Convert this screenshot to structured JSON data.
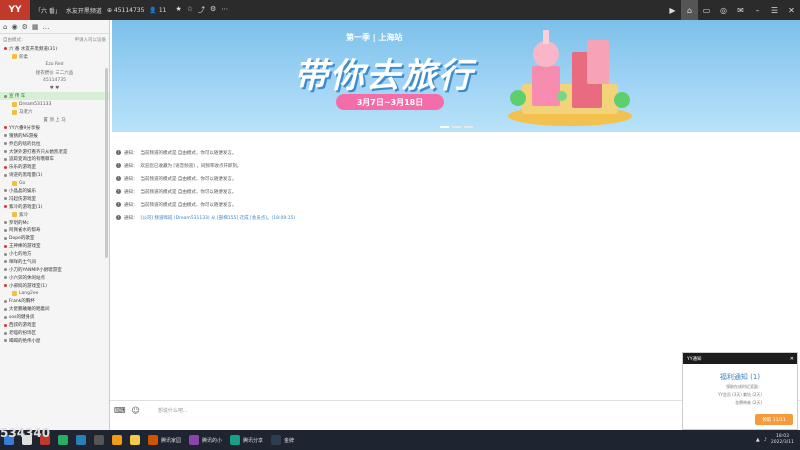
{
  "titlebar": {
    "channel_name": "「六 番」",
    "channel_desc": "水友开黑频道",
    "channel_id": "45114735",
    "online_count": "11",
    "buttons": [
      "video",
      "home",
      "screen",
      "game",
      "mail",
      "mini",
      "menu",
      "close"
    ]
  },
  "sidebar": {
    "mode_label": "自由模式：",
    "entry_hint": "申请入司以设备",
    "items": [
      {
        "text": "六 番   水友开黑频道(31)",
        "kind": "main"
      },
      {
        "text": "卯柔",
        "kind": "sub"
      },
      {
        "text": "Ezo Red",
        "kind": "center"
      },
      {
        "text": "接衣攒价 三二六品",
        "kind": "center"
      },
      {
        "text": "45114735",
        "kind": "center"
      },
      {
        "text": "♥  ♥",
        "kind": "center"
      },
      {
        "text": "宣 传 车",
        "kind": "sel"
      },
      {
        "text": "Dream531133",
        "kind": "sub"
      },
      {
        "text": "马老六",
        "kind": "sub"
      },
      {
        "text": "置  顶  上  马",
        "kind": "center"
      },
      {
        "text": "YY六番9分享报",
        "kind": "main"
      },
      {
        "text": "猜猜的NS游报",
        "kind": "main"
      },
      {
        "text": "乔启的啥的比拉",
        "kind": "main"
      },
      {
        "text": "大饼外游打看齐只从她凯老是",
        "kind": "main"
      },
      {
        "text": "追踪变询出的有哦嘶车",
        "kind": "main"
      },
      {
        "text": "乐乐的游戏室",
        "kind": "main"
      },
      {
        "text": "诗逆的黑暗量(1)",
        "kind": "main"
      },
      {
        "text": "Go",
        "kind": "sub"
      },
      {
        "text": "小晶晶的娱乐",
        "kind": "main"
      },
      {
        "text": "冯起伤游戏室",
        "kind": "main"
      },
      {
        "text": "紫冷的游戏室(1)",
        "kind": "main"
      },
      {
        "text": "紫冷",
        "kind": "sub"
      },
      {
        "text": "罗玥的Mc",
        "kind": "main"
      },
      {
        "text": "阿佩雀水的帮寿",
        "kind": "main"
      },
      {
        "text": "Dope的歌室",
        "kind": "main"
      },
      {
        "text": "王神棒的游戏室",
        "kind": "main"
      },
      {
        "text": "小七的地方",
        "kind": "main"
      },
      {
        "text": "咩咩的土气间",
        "kind": "main"
      },
      {
        "text": "小刀的YANMIP小厨嗯游室",
        "kind": "main"
      },
      {
        "text": "小六郊的休闲站点",
        "kind": "main"
      },
      {
        "text": "小邪捣的游戏室(1)",
        "kind": "main"
      },
      {
        "text": "Lang2ee",
        "kind": "sub"
      },
      {
        "text": "Frank的胸杯",
        "kind": "main"
      },
      {
        "text": "大佬鹏蛐蛐的晒着间",
        "kind": "main"
      },
      {
        "text": "sos的健身房",
        "kind": "main"
      },
      {
        "text": "西叔的游戏室",
        "kind": "main"
      },
      {
        "text": "老喵的扮饰区",
        "kind": "main"
      },
      {
        "text": "喝喝的绝伟小屋",
        "kind": "main"
      }
    ]
  },
  "banner": {
    "subtitle": "第一季 | 上海站",
    "title": "带你去旅行",
    "date": "3月7日~3月18日"
  },
  "notices": [
    {
      "prefix": "通知：",
      "text": "当前频道的模式是 自由模式，你可以随便发言。"
    },
    {
      "prefix": "通知：",
      "text": "欢迎您已收藏为 [语音频道] ，同频率收点开即刻。"
    },
    {
      "prefix": "通知：",
      "text": "当前频道的模式是 自由模式，你可以随便发言。"
    },
    {
      "prefix": "通知：",
      "text": "当前频道的模式是 自由模式，你可以随便发言。"
    },
    {
      "prefix": "通知：",
      "text": "当前频道的模式是 自由模式，你可以随便发言。"
    },
    {
      "prefix": "通知：",
      "text": "[公司] 频道哗班 (Dream531133) 从 [部梯155] 迁成 [会员点]。(18:09:15)"
    }
  ],
  "input": {
    "placeholder": "想说什么吧..."
  },
  "popup": {
    "header": "YY通知",
    "title": "福利通知 (1)",
    "lines": [
      "领取在成时近奖励：",
      "YY会员 (3天)    紫钻 (2天)",
      "金牌带来 (2天)"
    ],
    "button": "领取 11/11"
  },
  "taskbar": {
    "items": [
      "",
      "",
      "",
      "",
      "",
      "",
      "",
      "",
      "",
      ""
    ],
    "active_labels": [
      "腾讯家园",
      "腾讯的小",
      "腾讯分享",
      "金牌"
    ],
    "clock_time": "18:03",
    "clock_date": "2022/3/11"
  },
  "corner_counter": "534340"
}
